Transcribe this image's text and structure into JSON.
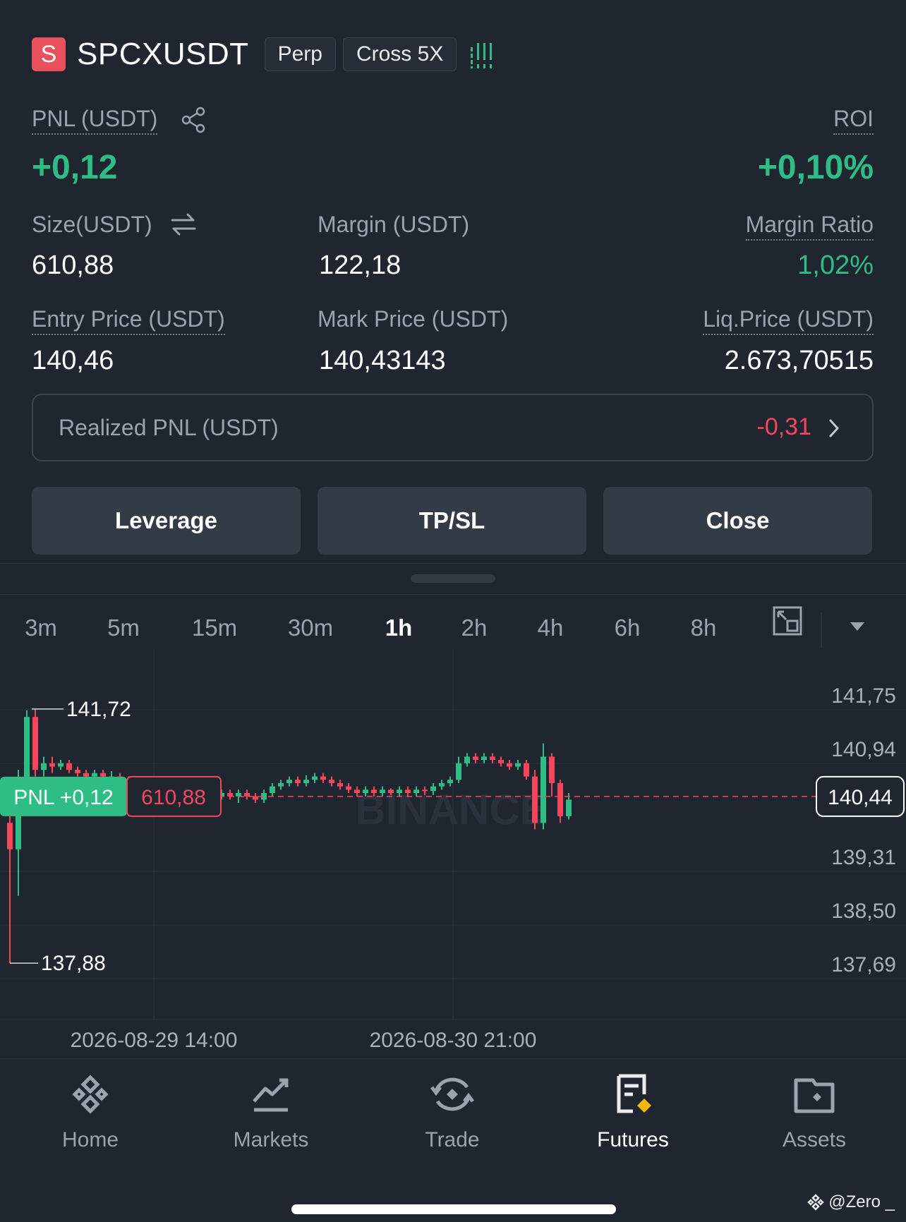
{
  "header": {
    "logo_letter": "S",
    "symbol": "SPCXUSDT",
    "contract_type": "Perp",
    "margin_mode": "Cross 5X",
    "meter_icon": "risk-meter-icon"
  },
  "position": {
    "pnl_label": "PNL (USDT)",
    "pnl_value": "+0,12",
    "roi_label": "ROI",
    "roi_value": "+0,10%",
    "size_label": "Size(USDT)",
    "size_value": "610,88",
    "margin_label": "Margin (USDT)",
    "margin_value": "122,18",
    "margin_ratio_label": "Margin Ratio",
    "margin_ratio_value": "1,02%",
    "entry_label": "Entry Price (USDT)",
    "entry_value": "140,46",
    "mark_label": "Mark Price (USDT)",
    "mark_value": "140,43143",
    "liq_label": "Liq.Price (USDT)",
    "liq_value": "2.673,70515"
  },
  "realized": {
    "label": "Realized PNL (USDT)",
    "value": "-0,31"
  },
  "actions": {
    "leverage": "Leverage",
    "tpsl": "TP/SL",
    "close": "Close"
  },
  "intervals": [
    "3m",
    "5m",
    "15m",
    "30m",
    "1h",
    "2h",
    "4h",
    "6h",
    "8h"
  ],
  "active_interval": "1h",
  "chart_data": {
    "type": "candlestick",
    "y_ticks": [
      "141,75",
      "140,94",
      "140,44",
      "139,31",
      "138,50",
      "137,69"
    ],
    "y_tick_values": [
      141.75,
      140.94,
      140.44,
      139.31,
      138.5,
      137.69
    ],
    "x_ticks": [
      "2026-08-29 14:00",
      "2026-08-30 21:00"
    ],
    "high_label": "141,72",
    "low_label": "137,88",
    "current_price": "140,44",
    "pnl_tag": "PNL +0,12",
    "size_tag": "610,88",
    "watermark": "BINANCE",
    "candles": [
      [
        140.0,
        139.6,
        140.2,
        137.88
      ],
      [
        139.6,
        140.6,
        140.8,
        138.9
      ],
      [
        140.6,
        141.6,
        141.7,
        140.3
      ],
      [
        141.6,
        140.8,
        141.72,
        140.7
      ],
      [
        140.8,
        140.9,
        141.0,
        140.7
      ],
      [
        140.9,
        140.85,
        141.0,
        140.75
      ],
      [
        140.85,
        140.9,
        140.95,
        140.8
      ],
      [
        140.9,
        140.8,
        140.95,
        140.75
      ],
      [
        140.8,
        140.75,
        140.85,
        140.7
      ],
      [
        140.75,
        140.7,
        140.8,
        140.65
      ],
      [
        140.7,
        140.75,
        140.8,
        140.65
      ],
      [
        140.75,
        140.7,
        140.8,
        140.6
      ],
      [
        140.7,
        140.7,
        140.78,
        140.62
      ],
      [
        140.7,
        140.65,
        140.75,
        140.6
      ],
      [
        140.65,
        140.6,
        140.7,
        140.55
      ],
      [
        140.6,
        140.65,
        140.7,
        140.55
      ],
      [
        140.65,
        140.6,
        140.7,
        140.55
      ],
      [
        140.6,
        140.55,
        140.65,
        140.5
      ],
      [
        140.55,
        140.5,
        140.6,
        140.45
      ],
      [
        140.5,
        140.5,
        140.58,
        140.42
      ],
      [
        140.5,
        140.48,
        140.55,
        140.4
      ],
      [
        140.48,
        140.45,
        140.55,
        140.4
      ],
      [
        140.45,
        140.5,
        140.55,
        140.4
      ],
      [
        140.5,
        140.45,
        140.55,
        140.38
      ],
      [
        140.45,
        140.4,
        140.5,
        140.35
      ],
      [
        140.4,
        140.45,
        140.5,
        140.35
      ],
      [
        140.45,
        140.4,
        140.5,
        140.35
      ],
      [
        140.4,
        140.45,
        140.5,
        140.3
      ],
      [
        140.45,
        140.4,
        140.5,
        140.35
      ],
      [
        140.4,
        140.35,
        140.45,
        140.3
      ],
      [
        140.35,
        140.45,
        140.5,
        140.3
      ],
      [
        140.45,
        140.55,
        140.6,
        140.4
      ],
      [
        140.55,
        140.6,
        140.65,
        140.5
      ],
      [
        140.6,
        140.65,
        140.7,
        140.55
      ],
      [
        140.65,
        140.6,
        140.7,
        140.55
      ],
      [
        140.6,
        140.65,
        140.72,
        140.55
      ],
      [
        140.65,
        140.7,
        140.75,
        140.6
      ],
      [
        140.7,
        140.65,
        140.75,
        140.6
      ],
      [
        140.65,
        140.6,
        140.7,
        140.55
      ],
      [
        140.6,
        140.55,
        140.65,
        140.5
      ],
      [
        140.55,
        140.5,
        140.6,
        140.45
      ],
      [
        140.5,
        140.45,
        140.55,
        140.4
      ],
      [
        140.45,
        140.5,
        140.55,
        140.4
      ],
      [
        140.5,
        140.45,
        140.55,
        140.4
      ],
      [
        140.45,
        140.5,
        140.55,
        140.4
      ],
      [
        140.5,
        140.45,
        140.52,
        140.42
      ],
      [
        140.45,
        140.5,
        140.55,
        140.4
      ],
      [
        140.5,
        140.45,
        140.55,
        140.4
      ],
      [
        140.45,
        140.5,
        140.55,
        140.4
      ],
      [
        140.5,
        140.48,
        140.55,
        140.42
      ],
      [
        140.48,
        140.55,
        140.6,
        140.42
      ],
      [
        140.55,
        140.6,
        140.65,
        140.5
      ],
      [
        140.6,
        140.65,
        140.7,
        140.55
      ],
      [
        140.65,
        140.9,
        141.0,
        140.6
      ],
      [
        140.9,
        141.0,
        141.05,
        140.85
      ],
      [
        141.0,
        140.95,
        141.05,
        140.9
      ],
      [
        140.95,
        141.0,
        141.05,
        140.9
      ],
      [
        141.0,
        140.95,
        141.05,
        140.9
      ],
      [
        140.95,
        140.9,
        141.0,
        140.85
      ],
      [
        140.9,
        140.85,
        140.95,
        140.8
      ],
      [
        140.85,
        140.9,
        140.95,
        140.8
      ],
      [
        140.9,
        140.7,
        140.95,
        140.65
      ],
      [
        140.7,
        140.0,
        140.8,
        139.9
      ],
      [
        140.0,
        141.0,
        141.2,
        139.9
      ],
      [
        141.0,
        140.6,
        141.05,
        140.4
      ],
      [
        140.6,
        140.1,
        140.65,
        140.0
      ],
      [
        140.1,
        140.35,
        140.45,
        140.05
      ]
    ]
  },
  "nav": [
    {
      "label": "Home",
      "icon": "home-icon"
    },
    {
      "label": "Markets",
      "icon": "markets-icon"
    },
    {
      "label": "Trade",
      "icon": "trade-icon"
    },
    {
      "label": "Futures",
      "icon": "futures-icon"
    },
    {
      "label": "Assets",
      "icon": "assets-icon"
    }
  ],
  "watermark_text": "@Zero _",
  "colors": {
    "up": "#2ebd85",
    "down": "#f6465d",
    "bg": "#1f2630",
    "accent": "#f0b90b"
  }
}
